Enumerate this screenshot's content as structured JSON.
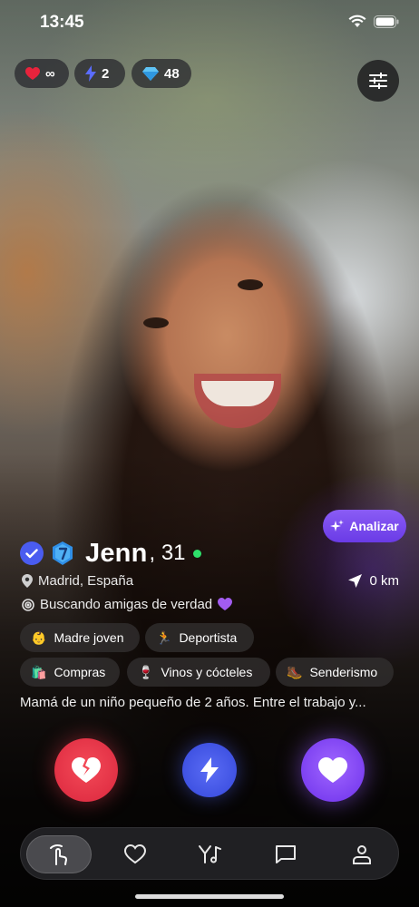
{
  "status": {
    "time": "13:45"
  },
  "counters": {
    "likes": {
      "icon": "heart-icon",
      "value": "∞"
    },
    "boosts": {
      "icon": "bolt-icon",
      "value": "2"
    },
    "gems": {
      "icon": "diamond-icon",
      "value": "48"
    }
  },
  "analyze": {
    "label": "Analizar"
  },
  "profile": {
    "name": "Jenn",
    "age": ", 31",
    "location": "Madrid, España",
    "distance": "0 km",
    "looking_for": "Buscando amigas de verdad",
    "tags": [
      {
        "emoji": "👶",
        "label": "Madre joven"
      },
      {
        "emoji": "🏃",
        "label": "Deportista"
      },
      {
        "emoji": "🛍️",
        "label": "Compras"
      },
      {
        "emoji": "🍷",
        "label": "Vinos y cócteles"
      },
      {
        "emoji": "🥾",
        "label": "Senderismo"
      }
    ],
    "bio": "Mamá de un niño pequeño de 2 años. Entre el trabajo y..."
  },
  "actions": {
    "pass": "broken-heart-icon",
    "boost": "bolt-icon",
    "like": "heart-icon"
  },
  "nav": [
    "swipe-icon",
    "heart-icon",
    "match-music-icon",
    "chat-icon",
    "profile-icon"
  ],
  "colors": {
    "accent": "#7a3ef0",
    "pass": "#e23145",
    "boost": "#3c4fe0",
    "online": "#2ee06a"
  }
}
